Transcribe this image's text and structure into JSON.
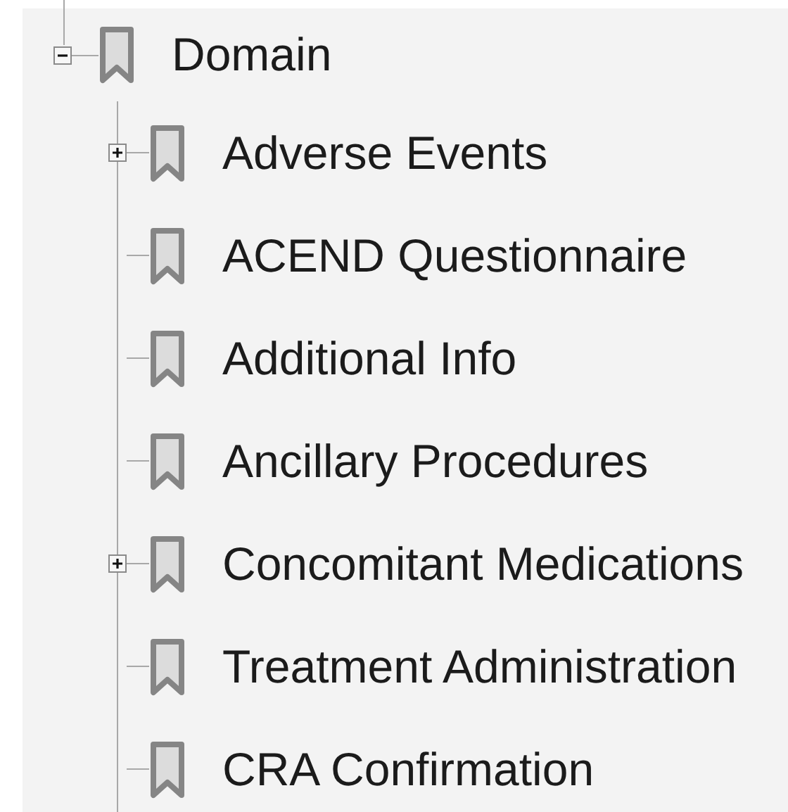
{
  "tree": [
    {
      "label": "Domain",
      "kind": "branch",
      "expanded": true,
      "children": [
        {
          "label": "Adverse Events",
          "kind": "branch",
          "expanded": false
        },
        {
          "label": "ACEND Questionnaire",
          "kind": "leaf"
        },
        {
          "label": "Additional Info",
          "kind": "leaf"
        },
        {
          "label": "Ancillary Procedures",
          "kind": "leaf"
        },
        {
          "label": "Concomitant Medications",
          "kind": "branch",
          "expanded": false
        },
        {
          "label": "Treatment Administration",
          "kind": "leaf"
        },
        {
          "label": "CRA Confirmation",
          "kind": "leaf"
        }
      ]
    }
  ]
}
